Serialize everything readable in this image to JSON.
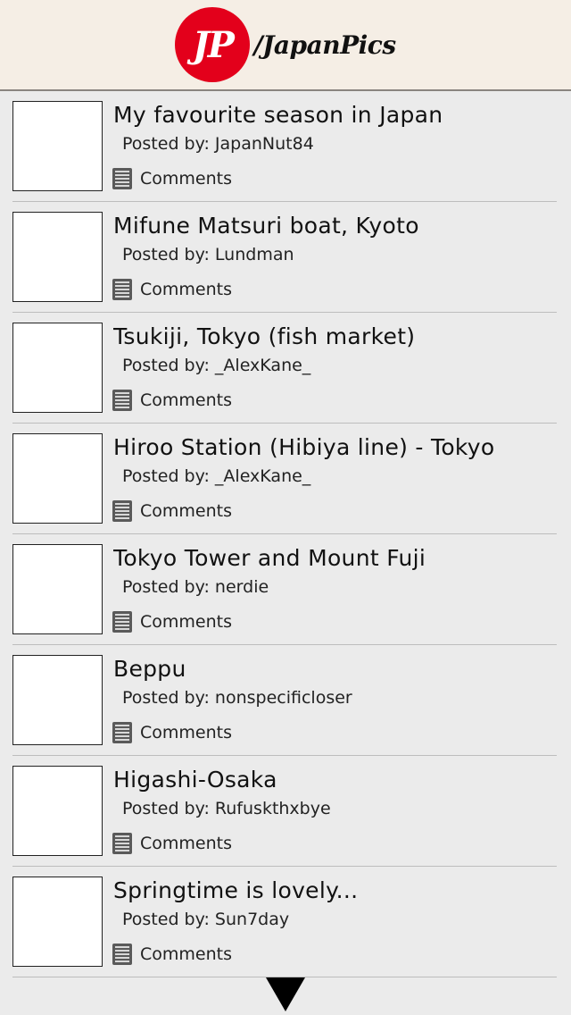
{
  "header": {
    "logo_text": "JP",
    "subreddit": "/JapanPics"
  },
  "posts": [
    {
      "title": "My favourite season in Japan",
      "posted_by_label": "Posted by:",
      "author": "JapanNut84",
      "comments_label": "Comments"
    },
    {
      "title": "Mifune Matsuri boat, Kyoto",
      "posted_by_label": "Posted by:",
      "author": "Lundman",
      "comments_label": "Comments"
    },
    {
      "title": "Tsukiji, Tokyo (fish market)",
      "posted_by_label": "Posted by:",
      "author": "_AlexKane_",
      "comments_label": "Comments"
    },
    {
      "title": "Hiroo Station (Hibiya line) - Tokyo",
      "posted_by_label": "Posted by:",
      "author": "_AlexKane_",
      "comments_label": "Comments"
    },
    {
      "title": "Tokyo Tower and Mount Fuji",
      "posted_by_label": "Posted by:",
      "author": "nerdie",
      "comments_label": "Comments"
    },
    {
      "title": "Beppu",
      "posted_by_label": "Posted by:",
      "author": "nonspecificloser",
      "comments_label": "Comments"
    },
    {
      "title": "Higashi-Osaka",
      "posted_by_label": "Posted by:",
      "author": "Rufuskthxbye",
      "comments_label": "Comments"
    },
    {
      "title": "Springtime is lovely...",
      "posted_by_label": "Posted by:",
      "author": "Sun7day",
      "comments_label": "Comments"
    }
  ],
  "colors": {
    "logo_red": "#e3001b",
    "header_bg": "#f5eee5",
    "page_bg": "#ebebeb"
  },
  "icons": {
    "comments": "comments-icon",
    "more": "down-arrow-icon"
  }
}
